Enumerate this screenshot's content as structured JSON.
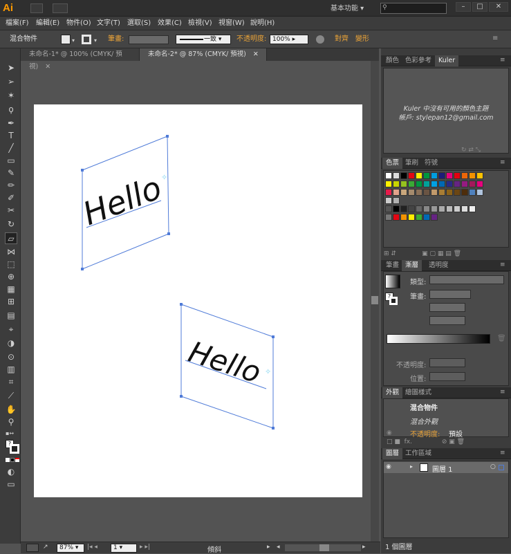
{
  "app": {
    "logo": "Ai",
    "workspace": "基本功能",
    "search_placeholder": ""
  },
  "menu": [
    "檔案(F)",
    "編輯(E)",
    "物件(O)",
    "文字(T)",
    "選取(S)",
    "效果(C)",
    "檢視(V)",
    "視窗(W)",
    "說明(H)"
  ],
  "control": {
    "object_type": "混合物件",
    "stroke_label": "筆畫:",
    "stroke_style": "一致",
    "opacity_label": "不透明度:",
    "opacity_value": "100%",
    "align_label": "對齊",
    "transform_label": "變形"
  },
  "tabs": [
    "未命名-1* @ 100% (CMYK/ 預視)",
    "未命名-2* @ 87% (CMYK/ 預視)"
  ],
  "artwork": {
    "text1": "Hello",
    "text2": "Hello"
  },
  "kuler": {
    "tabs": [
      "顏色",
      "色彩參考",
      "Kuler"
    ],
    "message": "Kuler 中沒有可用的顏色主題",
    "account": "帳戶: stylepan12@gmail.com"
  },
  "swatches": {
    "tabs": [
      "色票",
      "筆刷",
      "符號"
    ]
  },
  "gradient": {
    "tabs": [
      "筆畫",
      "漸層",
      "透明度"
    ],
    "type_label": "類型:",
    "stroke_label": "筆畫:",
    "opacity_label": "不透明度:",
    "position_label": "位置:"
  },
  "appearance": {
    "tabs": [
      "外觀",
      "繪圖樣式"
    ],
    "object_type": "混合物件",
    "row": "混合外觀",
    "opacity_label": "不透明度:",
    "opacity_value": "預設"
  },
  "layers": {
    "tabs": [
      "圖層",
      "工作區域"
    ],
    "layer_name": "圖層 1",
    "count": "1 個圖層"
  },
  "status": {
    "zoom": "87%",
    "page": "1",
    "tool_name": "傾斜"
  },
  "colors": {
    "bg": "#535353",
    "panel": "#3c3c3c",
    "accent": "#e8a238",
    "path": "#4f7bd8"
  }
}
